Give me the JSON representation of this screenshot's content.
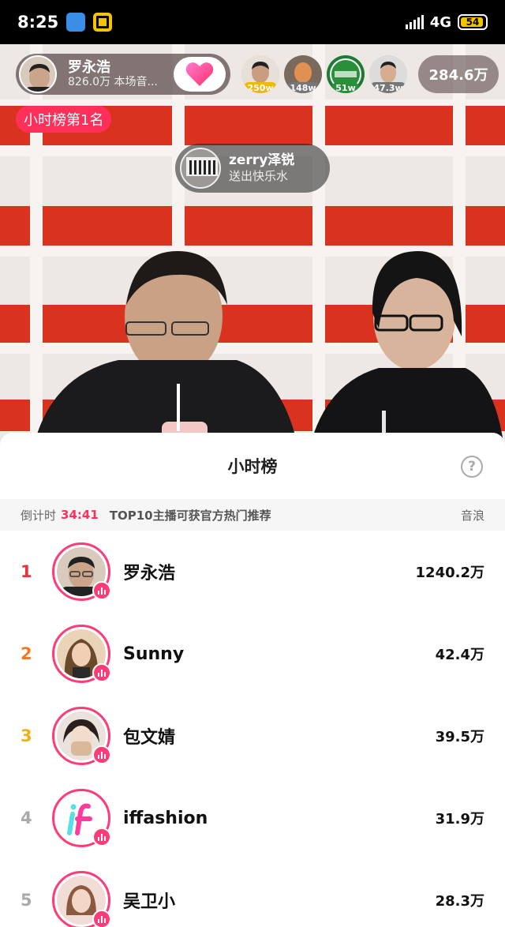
{
  "status_bar": {
    "time": "8:25",
    "network": "4G",
    "battery": "54",
    "icons": [
      "app-blue-icon",
      "app-yellow-icon",
      "signal-icon",
      "battery-icon"
    ]
  },
  "live": {
    "anchor": {
      "name": "罗永浩",
      "subtitle": "826.0万 本场音..."
    },
    "top_viewers": [
      {
        "badge": "250w",
        "badge_color": "#f2b800"
      },
      {
        "badge": "148w",
        "badge_color": "#777777"
      },
      {
        "badge": "51w",
        "badge_color": "#2a8f3b"
      },
      {
        "badge": "47.3w",
        "badge_color": "#777777"
      }
    ],
    "viewer_count": "284.6万",
    "rank_tag": "小时榜第1名",
    "gift": {
      "user": "zerry泽锐",
      "message": "送出快乐水"
    }
  },
  "sheet": {
    "title": "小时榜",
    "help": "?",
    "countdown_label": "倒计时",
    "countdown_value": "34:41",
    "promo": "TOP10主播可获官方热门推荐",
    "unit_label": "音浪",
    "rows": [
      {
        "rank": "1",
        "name": "罗永浩",
        "score": "1240.2万",
        "rank_color": "#e8333d",
        "avatar_color": "#d8cbbd"
      },
      {
        "rank": "2",
        "name": "Sunny",
        "score": "42.4万",
        "rank_color": "#ef7a2a",
        "avatar_color": "#c79a72"
      },
      {
        "rank": "3",
        "name": "包文婧",
        "score": "39.5万",
        "rank_color": "#e8b21a",
        "avatar_color": "#e5cdb8"
      },
      {
        "rank": "4",
        "name": "iffashion",
        "score": "31.9万",
        "rank_color": "#aaaaaa",
        "avatar_color": "#ffffff"
      },
      {
        "rank": "5",
        "name": "吴卫小",
        "score": "28.3万",
        "rank_color": "#aaaaaa",
        "avatar_color": "#e8c8c0"
      }
    ]
  },
  "colors": {
    "accent": "#ff2f5a",
    "ring": "#ff3c78"
  }
}
